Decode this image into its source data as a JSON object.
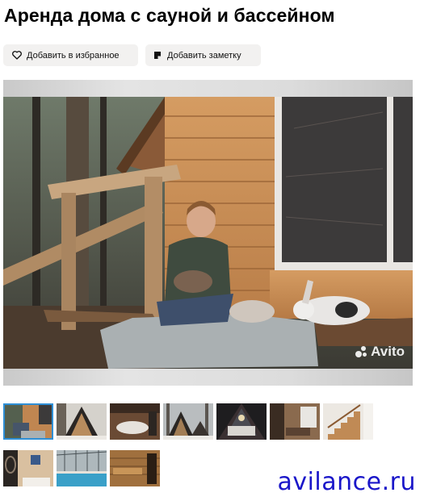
{
  "listing": {
    "title": "Аренда дома с сауной и бассейном"
  },
  "actions": {
    "favorite_label": "Добавить в избранное",
    "favorite_icon": "heart-icon",
    "note_label": "Добавить заметку",
    "note_icon": "note-icon"
  },
  "gallery": {
    "main_photo_watermark": "Avito",
    "selected_index": 0,
    "thumbnails": [
      {
        "subject": "boy-with-rabbits"
      },
      {
        "subject": "a-frame-house-exterior"
      },
      {
        "subject": "bathtub-room"
      },
      {
        "subject": "a-frame-house-forest"
      },
      {
        "subject": "a-frame-bedroom"
      },
      {
        "subject": "living-room"
      },
      {
        "subject": "wooden-staircase"
      },
      {
        "subject": "bathroom-mirror"
      },
      {
        "subject": "indoor-pool"
      },
      {
        "subject": "sauna"
      }
    ]
  },
  "overlay": {
    "site_text": "avilance.ru",
    "color": "#1a16c9"
  }
}
